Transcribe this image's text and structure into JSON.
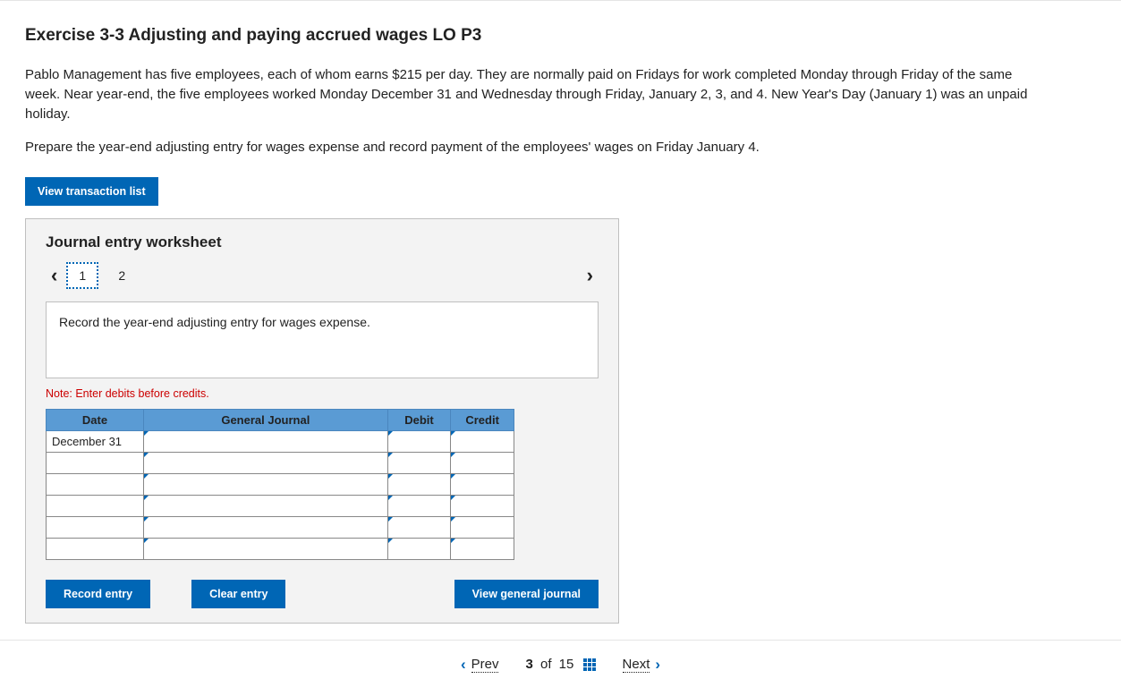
{
  "header": {
    "title": "Exercise 3-3 Adjusting and paying accrued wages LO P3"
  },
  "body": {
    "paragraph1": "Pablo Management has five employees, each of whom earns $215 per day. They are normally paid on Fridays for work completed Monday through Friday of the same week. Near year-end, the five employees worked Monday December 31 and Wednesday through Friday, January 2, 3, and 4. New Year's Day (January 1) was an unpaid holiday.",
    "paragraph2": "Prepare the year-end adjusting entry for wages expense and record payment of the employees' wages on Friday January 4."
  },
  "buttons": {
    "view_transaction_list": "View transaction list",
    "record_entry": "Record entry",
    "clear_entry": "Clear entry",
    "view_general_journal": "View general journal"
  },
  "worksheet": {
    "title": "Journal entry worksheet",
    "tabs": [
      "1",
      "2"
    ],
    "instruction": "Record the year-end adjusting entry for wages expense.",
    "note": "Note: Enter debits before credits.",
    "columns": {
      "date": "Date",
      "gj": "General Journal",
      "debit": "Debit",
      "credit": "Credit"
    },
    "rows": [
      {
        "date": "December 31",
        "gj": "",
        "debit": "",
        "credit": ""
      },
      {
        "date": "",
        "gj": "",
        "debit": "",
        "credit": ""
      },
      {
        "date": "",
        "gj": "",
        "debit": "",
        "credit": ""
      },
      {
        "date": "",
        "gj": "",
        "debit": "",
        "credit": ""
      },
      {
        "date": "",
        "gj": "",
        "debit": "",
        "credit": ""
      },
      {
        "date": "",
        "gj": "",
        "debit": "",
        "credit": ""
      }
    ]
  },
  "pager": {
    "prev": "Prev",
    "current": "3",
    "of_word": "of",
    "total": "15",
    "next": "Next"
  }
}
